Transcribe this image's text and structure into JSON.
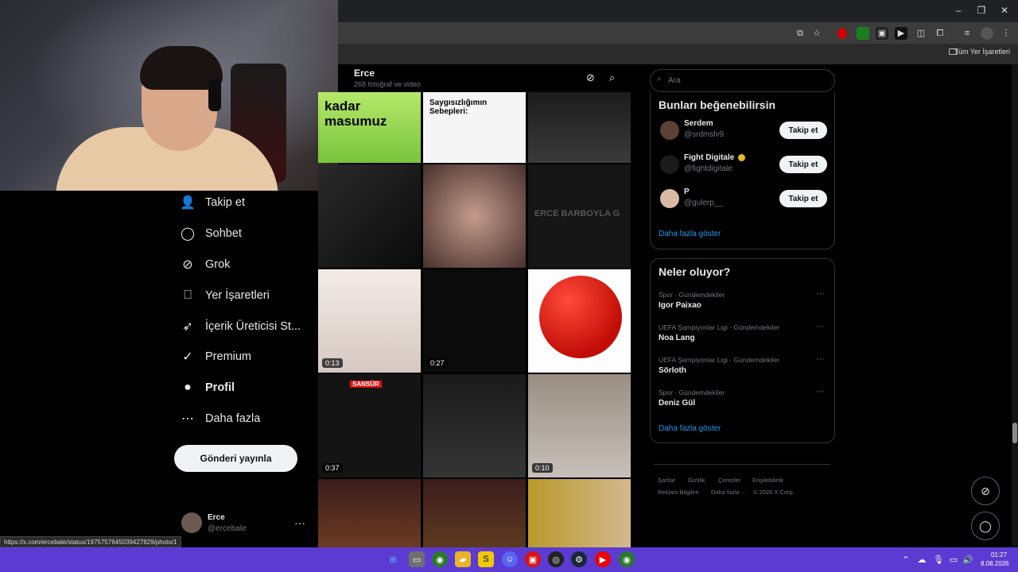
{
  "browser": {
    "bookmarks_all_label": "Tüm Yer İşaretleri",
    "status_url": "https://x.com/ercebale/status/1975757645039427829/photo/1",
    "window_controls": [
      "minimize",
      "restore",
      "close"
    ]
  },
  "nav": {
    "items": [
      {
        "label": "Takip et",
        "icon": "person-add-icon",
        "bold": false
      },
      {
        "label": "Sohbet",
        "icon": "chat-icon",
        "bold": false
      },
      {
        "label": "Grok",
        "icon": "grok-icon",
        "bold": false
      },
      {
        "label": "Yer İşaretleri",
        "icon": "bookmark-icon",
        "bold": false
      },
      {
        "label": "İçerik Üreticisi St...",
        "icon": "rocket-icon",
        "bold": false
      },
      {
        "label": "Premium",
        "icon": "verified-icon",
        "bold": false
      },
      {
        "label": "Profil",
        "icon": "profile-icon",
        "bold": true
      },
      {
        "label": "Daha fazla",
        "icon": "more-circle-icon",
        "bold": false
      }
    ],
    "post_button": "Gönderi yayınla",
    "account": {
      "name": "Erce",
      "handle": "@ercebale"
    }
  },
  "profile": {
    "name": "Erce",
    "media_count": "268 fotoğraf ve video"
  },
  "grid": {
    "tiles": [
      {
        "duration": "",
        "text": "kadar\nmasumuz"
      },
      {
        "duration": "",
        "text": "Saygısızlığımın Sebepleri:"
      },
      {
        "duration": "",
        "text": ""
      },
      {
        "duration": "",
        "text": ""
      },
      {
        "duration": "",
        "text": ""
      },
      {
        "duration": "",
        "text": "ERCE BARBOYLA G"
      },
      {
        "duration": "0:13",
        "text": ""
      },
      {
        "duration": "0:27",
        "text": ""
      },
      {
        "duration": "",
        "text": ""
      },
      {
        "duration": "0:37",
        "text": "SANSÜR"
      },
      {
        "duration": "",
        "text": ""
      },
      {
        "duration": "0:10",
        "text": ""
      },
      {
        "duration": "",
        "text": ""
      },
      {
        "duration": "",
        "text": ""
      },
      {
        "duration": "",
        "text": ""
      }
    ]
  },
  "search": {
    "placeholder": "Ara"
  },
  "suggestions": {
    "title": "Bunları beğenebilirsin",
    "users": [
      {
        "name": "Serdem",
        "handle": "@srdmslv9",
        "button": "Takip et"
      },
      {
        "name": "Fight Digitale",
        "handle": "@fightdigitale",
        "button": "Takip et"
      },
      {
        "name": "P",
        "handle": "@gulerp__",
        "button": "Takip et"
      }
    ],
    "show_more": "Daha fazla göster"
  },
  "trends": {
    "title": "Neler oluyor?",
    "items": [
      {
        "category": "Spor · Gündemdekiler",
        "name": "Igor Paixao"
      },
      {
        "category": "UEFA Şampiyonlar Ligi · Gündemdekiler",
        "name": "Noa Lang"
      },
      {
        "category": "UEFA Şampiyonlar Ligi · Gündemdekiler",
        "name": "Sörloth"
      },
      {
        "category": "Spor · Gündemdekiler",
        "name": "Deniz Gül"
      }
    ],
    "show_more": "Daha fazla göster"
  },
  "footer": {
    "line1": [
      "Şartlar",
      "Gizlilik",
      "Çerezler",
      "Erişilebilirlik"
    ],
    "line2": [
      "Reklam Bilgileri",
      "Daha fazla ···",
      "© 2026 X Corp."
    ]
  },
  "taskbar": {
    "time": "01:27",
    "date": "8.08.2026"
  },
  "colors": {
    "accent": "#1d9bf0",
    "taskbar": "#5b3bd1",
    "background": "#000000"
  }
}
